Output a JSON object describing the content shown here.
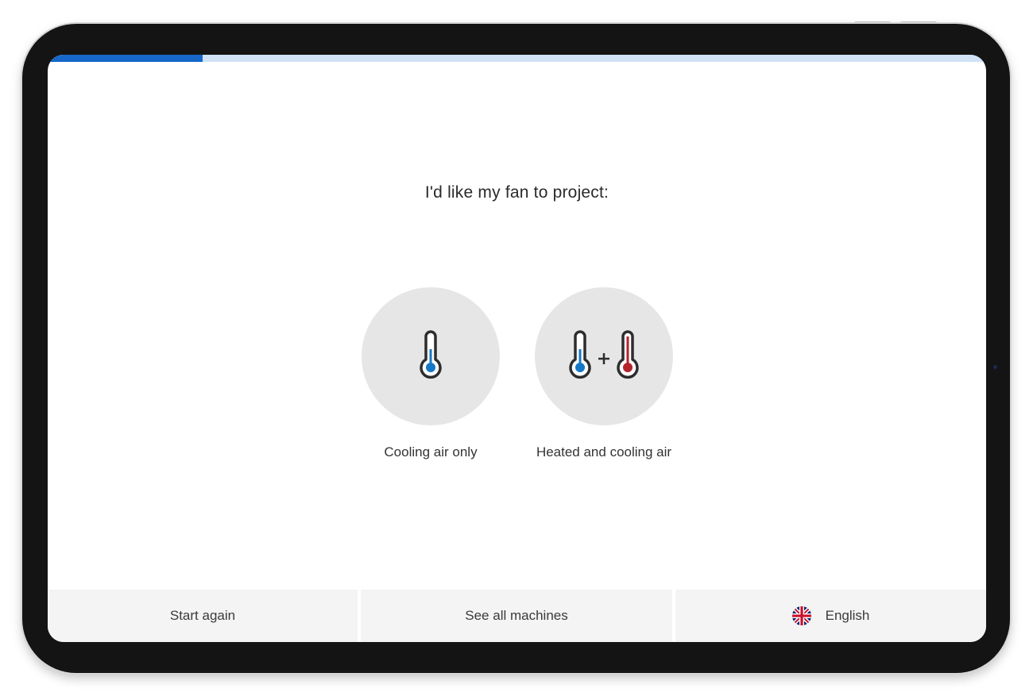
{
  "progress": {
    "value": 0.165,
    "fill_color": "#1667c9",
    "track_color": "#cfe2f6"
  },
  "question": {
    "text": "I'd like my fan to project:"
  },
  "options": [
    {
      "label": "Cooling air only",
      "icon": "thermometer-cold-icon"
    },
    {
      "label": "Heated and cooling air",
      "icon": "thermometer-cold-plus-hot-icon"
    }
  ],
  "footer": {
    "start_again": "Start again",
    "see_all": "See all machines",
    "language": {
      "label": "English",
      "icon": "uk-flag-icon"
    }
  },
  "colors": {
    "cold": "#1677c7",
    "hot": "#b5232a",
    "circle": "#e6e6e6"
  }
}
